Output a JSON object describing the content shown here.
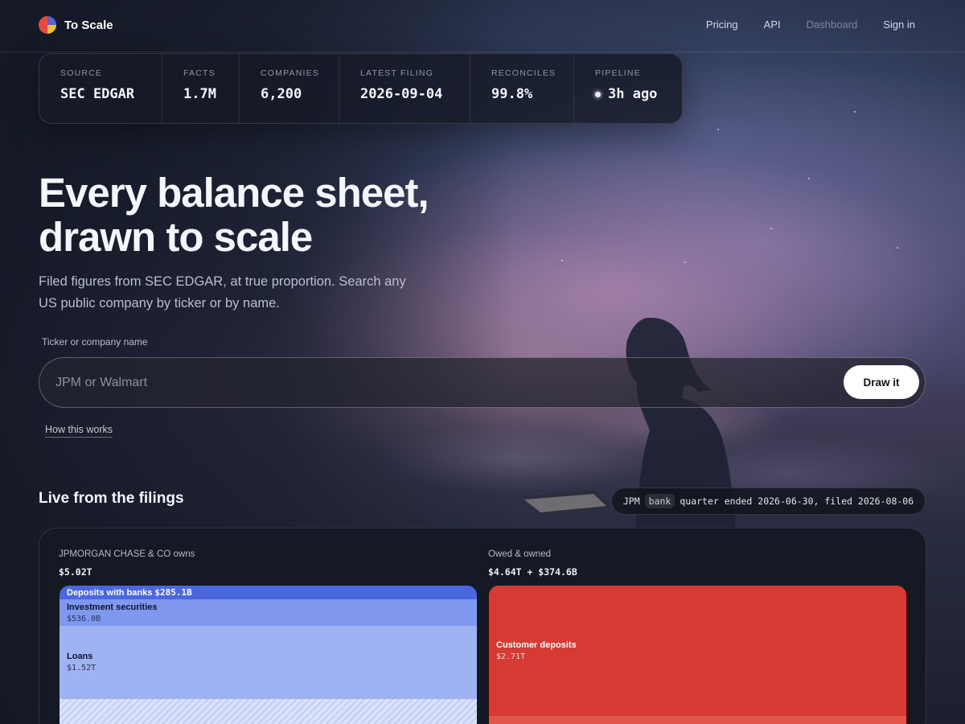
{
  "nav": {
    "brand": "To Scale",
    "links": [
      "Pricing",
      "API",
      "Dashboard",
      "Sign in"
    ]
  },
  "stats": [
    {
      "label": "SOURCE",
      "value": "SEC EDGAR"
    },
    {
      "label": "FACTS",
      "value": "1.7M"
    },
    {
      "label": "COMPANIES",
      "value": "6,200"
    },
    {
      "label": "LATEST FILING",
      "value": "2026-09-04"
    },
    {
      "label": "RECONCILES",
      "value": "99.8%"
    },
    {
      "label": "PIPELINE",
      "value": "3h ago"
    }
  ],
  "hero": {
    "title_line1": "Every balance sheet,",
    "title_line2": "drawn to scale",
    "subtitle": "Filed figures from SEC EDGAR, at true proportion. Search any US public company by ticker or by name."
  },
  "search": {
    "label": "Ticker or company name",
    "placeholder": "JPM or Walmart",
    "button": "Draw it",
    "help_link": "How this works"
  },
  "live": {
    "title": "Live from the filings",
    "filing": {
      "ticker": "JPM",
      "kind": "bank",
      "text": "quarter ended 2026-06-30, filed 2026-08-06"
    },
    "assets": {
      "heading": "JPMORGAN CHASE & CO owns",
      "total": "$5.02T",
      "segments": [
        {
          "name": "Deposits with banks",
          "value": "$285.1B"
        },
        {
          "name": "Investment securities",
          "value": "$536.0B"
        },
        {
          "name": "Loans",
          "value": "$1.52T"
        }
      ]
    },
    "liabilities": {
      "heading": "Owed & owned",
      "total": "$4.64T + $374.6B",
      "segments": [
        {
          "name": "Customer deposits",
          "value": "$2.71T"
        }
      ]
    },
    "colors": {
      "deposits": "#4a67e0",
      "securities": "#7f97ec",
      "loans": "#9fb3f3",
      "customer_deposits": "#d63a33"
    }
  }
}
